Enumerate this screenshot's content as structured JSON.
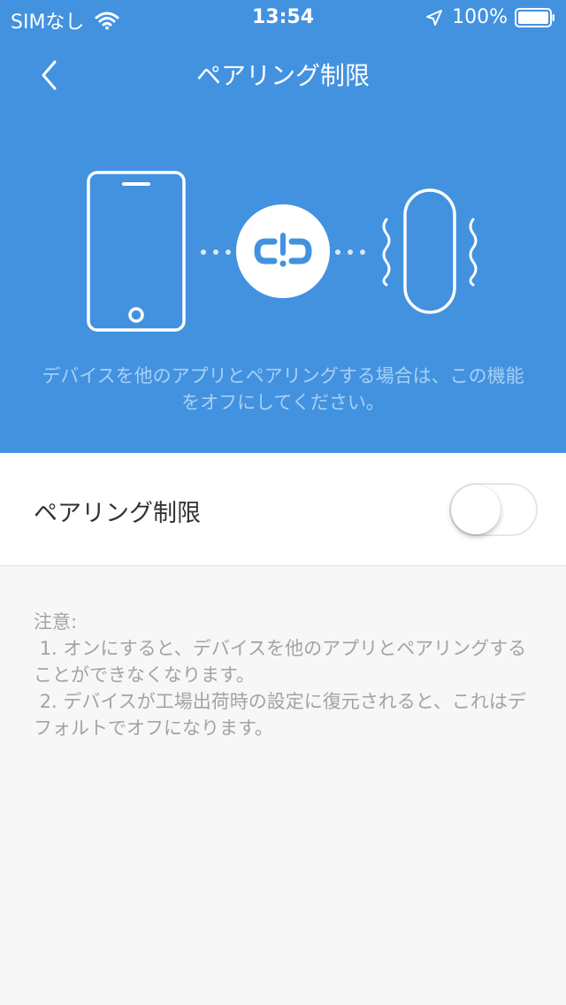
{
  "status_bar": {
    "carrier": "SIMなし",
    "time": "13:54",
    "battery": "100%",
    "icons": [
      "wifi-icon",
      "location-arrow-icon",
      "battery-icon"
    ]
  },
  "nav": {
    "title": "ペアリング制限",
    "back_icon": "chevron-left-icon"
  },
  "illustration": {
    "icons": [
      "phone-icon",
      "unlinked-icon",
      "band-icon"
    ]
  },
  "header": {
    "description": "デバイスを他のアプリとペアリングする場合は、この機能をオフにしてください。"
  },
  "setting": {
    "label": "ペアリング制限",
    "toggle_on": false
  },
  "notes": {
    "heading": "注意:",
    "item1": " 1. オンにすると、デバイスを他のアプリとペアリングすることができなくなります。",
    "item2": " 2. デバイスが工場出荷時の設定に復元されると、これはデフォルトでオフになります。"
  },
  "colors": {
    "header_bg": "#4292e0",
    "page_bg": "#f7f7f7",
    "text_muted": "#a3a3a3"
  }
}
